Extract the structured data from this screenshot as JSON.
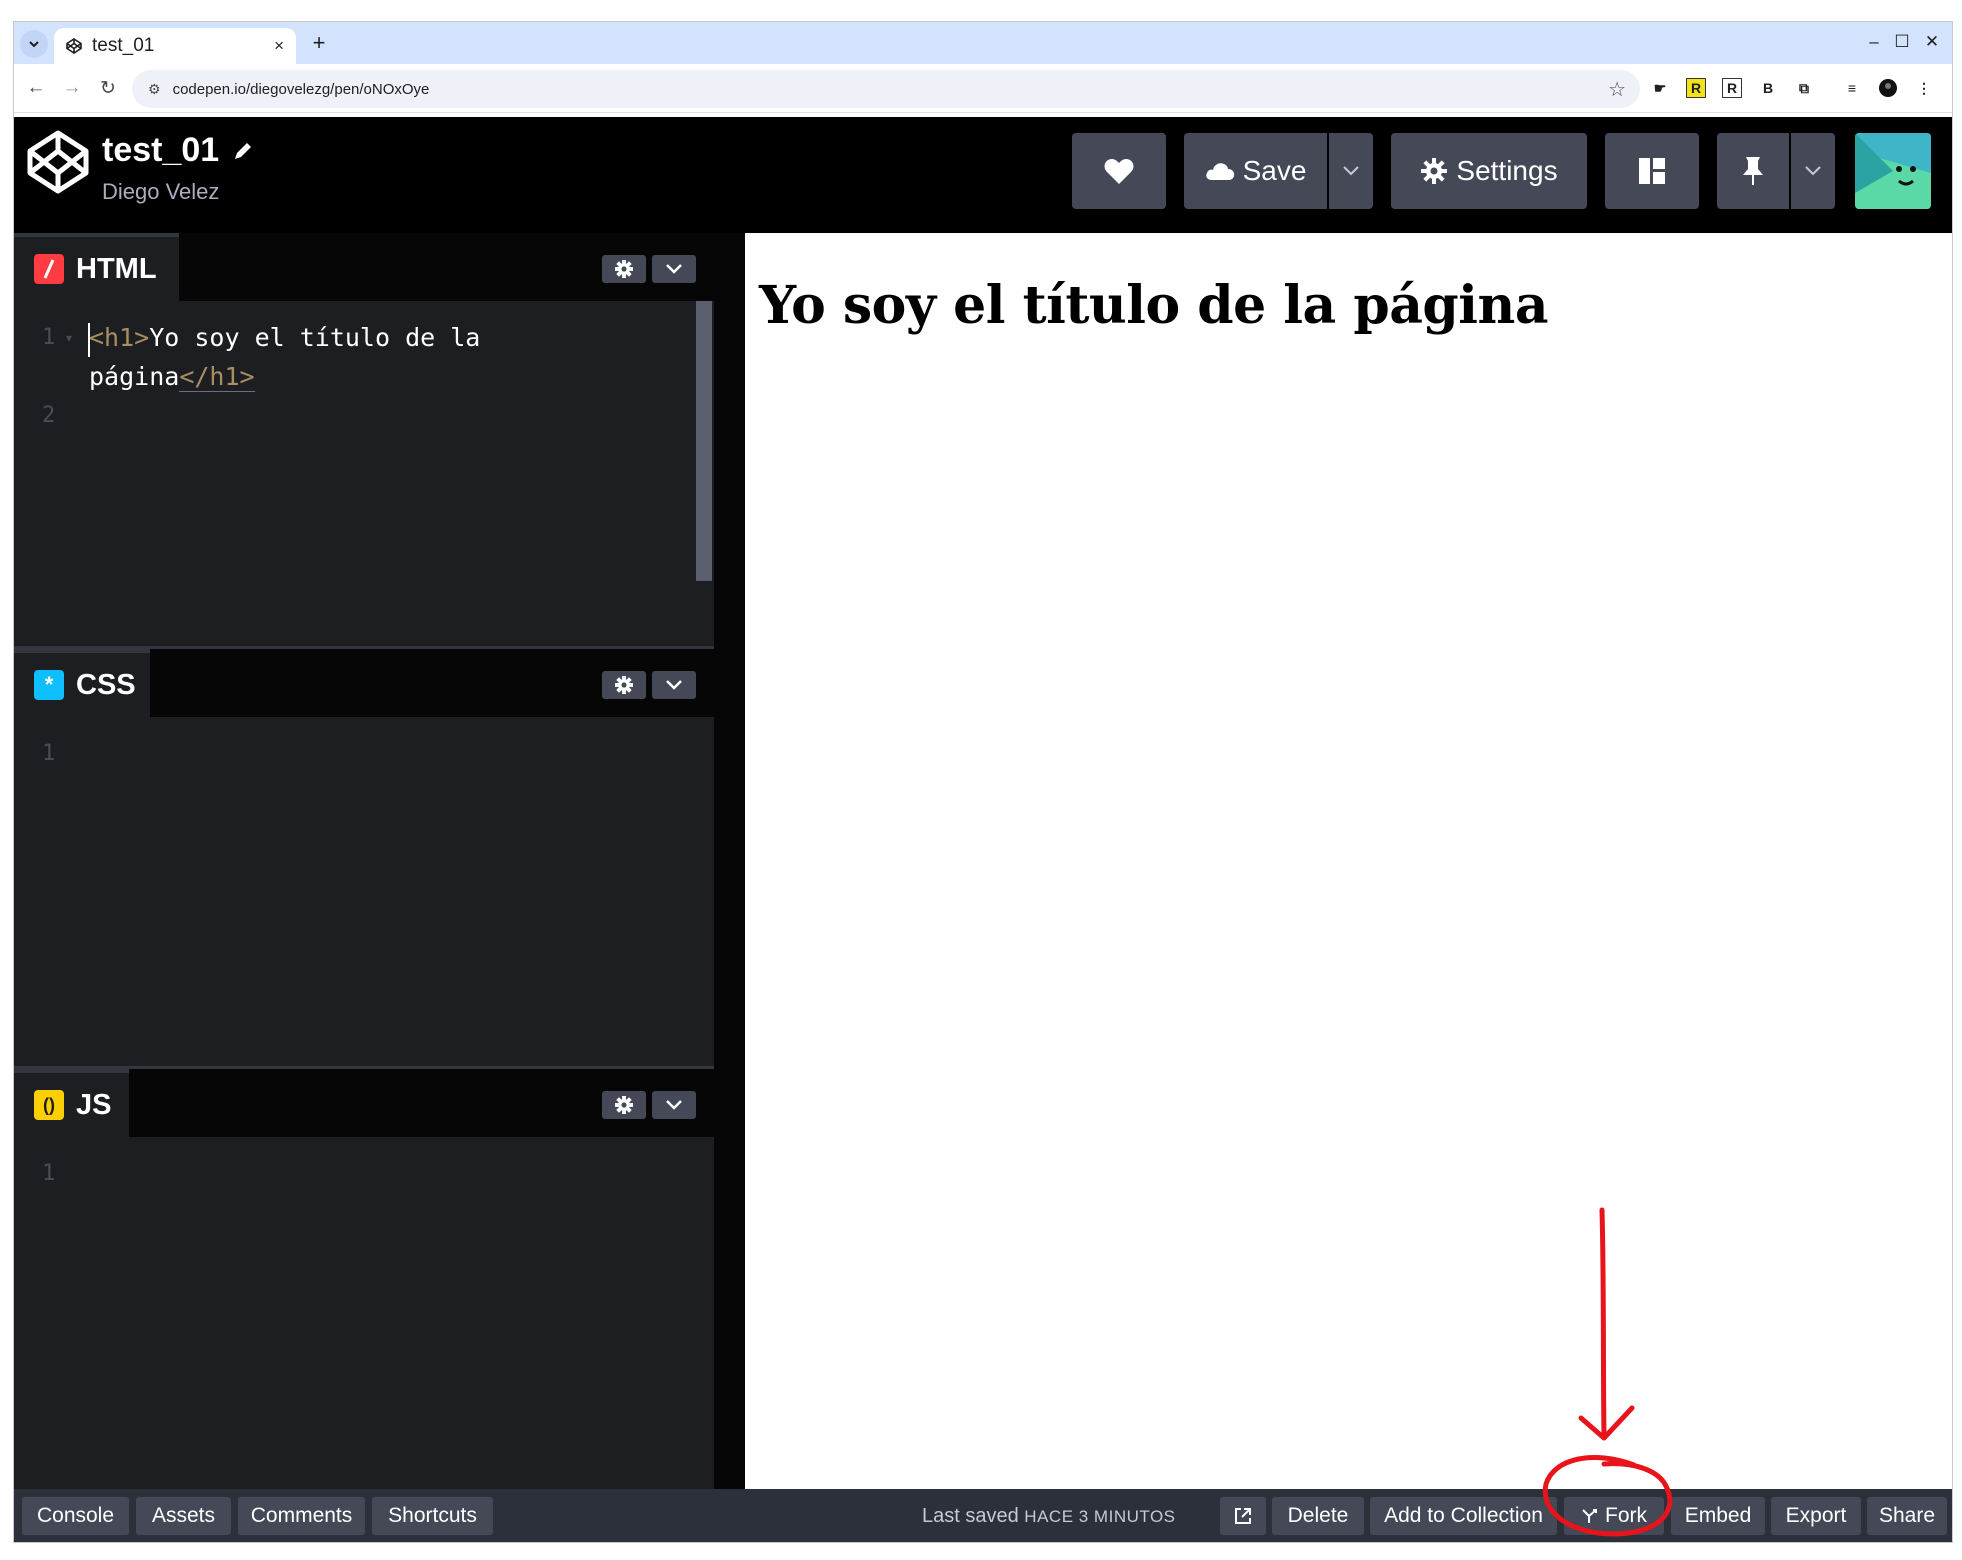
{
  "browser": {
    "tab_title": "test_01",
    "new_tab": "+",
    "tab_close": "×",
    "url": "codepen.io/diegovelezg/pen/oNOxOye",
    "window_controls": [
      "–",
      "☐",
      "✕"
    ]
  },
  "extensions": [
    "plugin-icon",
    "R",
    "R",
    "B",
    "puzzle-icon",
    "queue-icon",
    "profile-icon",
    "menu-icon"
  ],
  "header": {
    "pen_title": "test_01",
    "author": "Diego Velez",
    "save_label": "Save",
    "settings_label": "Settings"
  },
  "panes": [
    {
      "label": "HTML",
      "icon_color": "#ff3c41",
      "icon_glyph": "/"
    },
    {
      "label": "CSS",
      "icon_color": "#0ebeff",
      "icon_glyph": "*"
    },
    {
      "label": "JS",
      "icon_color": "#fcd000",
      "icon_glyph": "()"
    }
  ],
  "html_editor": {
    "line_numbers": [
      "1",
      "2"
    ],
    "line1_open_tag": "<h1>",
    "line1_text": "Yo soy el título de la",
    "line1b_text": "página",
    "line1_close_tag": "</h1>"
  },
  "css_editor": {
    "line_numbers": [
      "1"
    ]
  },
  "js_editor": {
    "line_numbers": [
      "1"
    ]
  },
  "preview": {
    "heading": "Yo soy el título de la página"
  },
  "footer": {
    "console": "Console",
    "assets": "Assets",
    "comments": "Comments",
    "shortcuts": "Shortcuts",
    "last_saved_prefix": "Last saved",
    "last_saved_when": "HACE 3 MINUTOS",
    "delete": "Delete",
    "add_to_collection": "Add to Collection",
    "fork": "Fork",
    "embed": "Embed",
    "export": "Export",
    "share": "Share"
  },
  "colors": {
    "header_bg": "#000000",
    "button_bg": "#444857",
    "editor_bg": "#1d1e22",
    "tag_color": "#a88f61",
    "annotation": "#e8141b"
  }
}
